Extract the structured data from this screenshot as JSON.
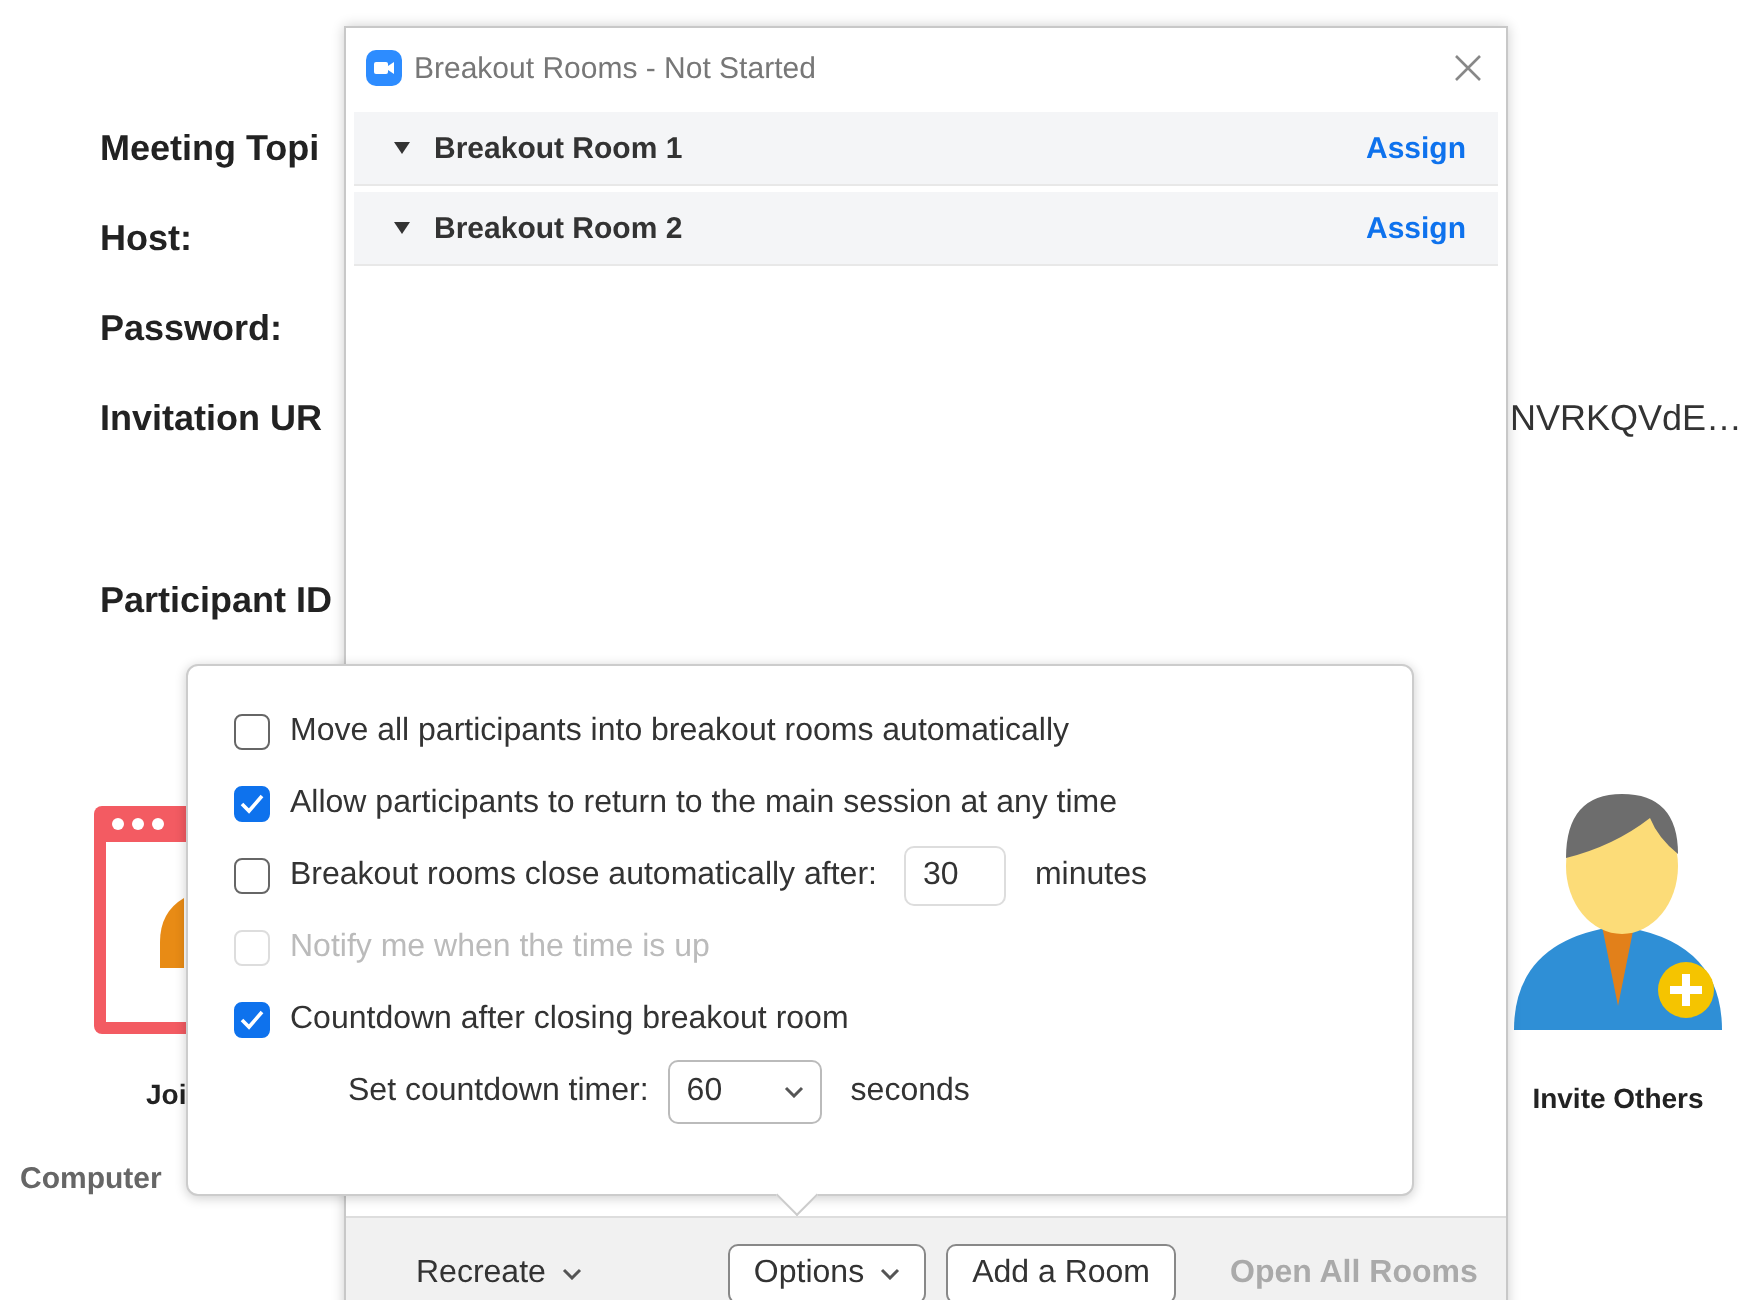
{
  "background": {
    "fields": [
      {
        "label": "Meeting Topi"
      },
      {
        "label": "Host:"
      },
      {
        "label": "Password:"
      },
      {
        "label": "Invitation UR",
        "value": "NVRKQVdE…"
      },
      {
        "label": "Participant ID"
      }
    ],
    "actions": [
      {
        "kind": "join",
        "label": "Joi"
      },
      {
        "kind": "invite",
        "label": "Invite Others"
      }
    ],
    "footer": "Computer"
  },
  "dialog": {
    "title": "Breakout Rooms - Not Started",
    "rooms": [
      {
        "name": "Breakout Room 1",
        "action": "Assign"
      },
      {
        "name": "Breakout Room 2",
        "action": "Assign"
      }
    ],
    "buttons": [
      {
        "kind": "menu",
        "label": "Recreate"
      },
      {
        "kind": "outlined-menu",
        "label": "Options"
      },
      {
        "kind": "outlined",
        "label": "Add a Room"
      },
      {
        "kind": "disabled",
        "label": "Open All Rooms"
      }
    ]
  },
  "options_popover": {
    "options": [
      {
        "kind": "checkbox",
        "label": "Move all participants into breakout rooms automatically",
        "checked": false,
        "disabled": false
      },
      {
        "kind": "checkbox",
        "label": "Allow participants to return to the main session at any time",
        "checked": true,
        "disabled": false
      },
      {
        "kind": "checkbox-input",
        "label": "Breakout rooms close automatically after:",
        "checked": false,
        "disabled": false,
        "value": "30",
        "unit": "minutes"
      },
      {
        "kind": "checkbox",
        "label": "Notify me when the time is up",
        "checked": false,
        "disabled": true
      },
      {
        "kind": "checkbox",
        "label": "Countdown after closing breakout room",
        "checked": true,
        "disabled": false
      },
      {
        "kind": "select",
        "label": "Set countdown timer:",
        "value": "60",
        "unit": "seconds"
      }
    ]
  }
}
